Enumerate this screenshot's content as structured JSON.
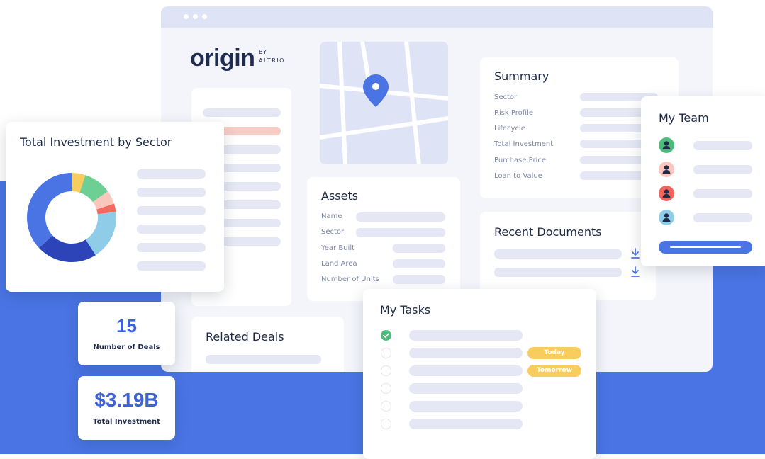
{
  "brand": {
    "logo_text": "origin",
    "by": "BY",
    "company": "ALTRIO"
  },
  "colors": {
    "accent": "#4a74e4",
    "success": "#4dbc7b",
    "warning": "#f8cc5f",
    "text_primary": "#1e2a48",
    "text_muted": "#7c86a2",
    "placeholder": "#e5e8f4"
  },
  "map": {
    "pin_icon": "map-pin-icon"
  },
  "summary": {
    "title": "Summary",
    "fields": [
      "Sector",
      "Risk Profile",
      "Lifecycle",
      "Total Investment",
      "Purchase Price",
      "Loan to Value"
    ]
  },
  "assets": {
    "title": "Assets",
    "fields": [
      "Name",
      "Sector",
      "Year Built",
      "Land Area",
      "Number of Units"
    ]
  },
  "recent_documents": {
    "title": "Recent Documents",
    "download_icon": "download-icon"
  },
  "related_deals": {
    "title": "Related Deals"
  },
  "team": {
    "title": "My Team",
    "members": [
      {
        "avatar_color": "#4dbc7b"
      },
      {
        "avatar_color": "#f9c7bd"
      },
      {
        "avatar_color": "#f0645c"
      },
      {
        "avatar_color": "#8fcce8"
      }
    ]
  },
  "tasks": {
    "title": "My Tasks",
    "items": [
      {
        "done": true,
        "tag": ""
      },
      {
        "done": false,
        "tag": "Today"
      },
      {
        "done": false,
        "tag": "Tomorrow"
      },
      {
        "done": false,
        "tag": ""
      },
      {
        "done": false,
        "tag": ""
      },
      {
        "done": false,
        "tag": ""
      }
    ]
  },
  "stats": {
    "deals": {
      "value": "15",
      "label": "Number of Deals"
    },
    "investment": {
      "value": "$3.19B",
      "label": "Total Investment"
    }
  },
  "chart_data": {
    "type": "pie",
    "title": "Total Investment by Sector",
    "donut": true,
    "slices": [
      {
        "value": 5,
        "color": "#f8cc5f"
      },
      {
        "value": 10,
        "color": "#6dcf93"
      },
      {
        "value": 5,
        "color": "#fac7bd"
      },
      {
        "value": 3,
        "color": "#f26b5e"
      },
      {
        "value": 18,
        "color": "#8fcce8"
      },
      {
        "value": 22,
        "color": "#2c44b8"
      },
      {
        "value": 37,
        "color": "#4a74e4"
      }
    ]
  }
}
